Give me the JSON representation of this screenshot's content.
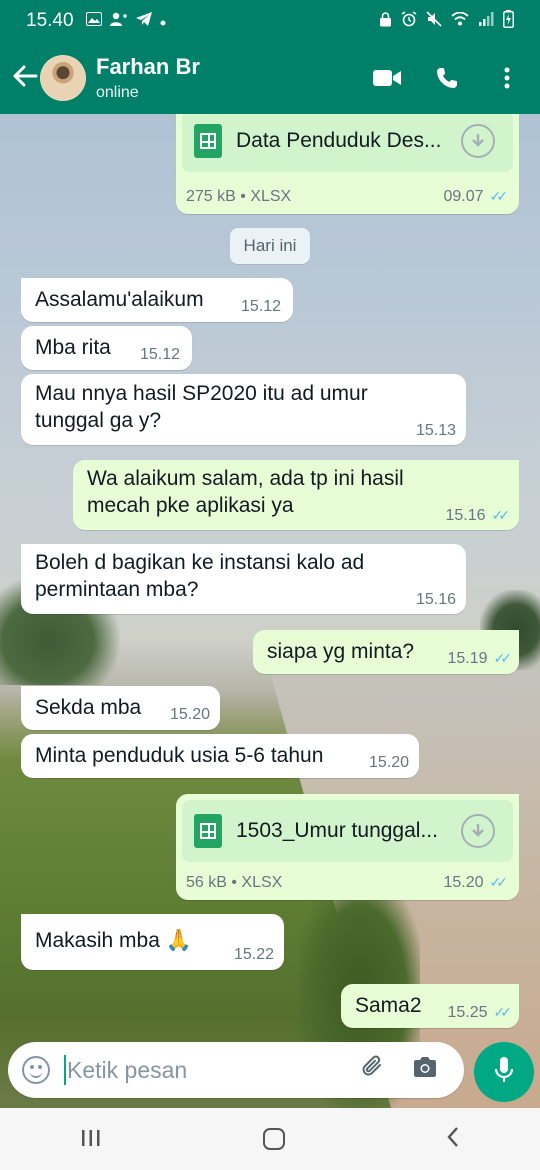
{
  "statusbar": {
    "time": "15.40"
  },
  "header": {
    "contact_name": "Farhan Br",
    "contact_status": "online"
  },
  "day_separator": "Hari ini",
  "messages": [
    {
      "kind": "document",
      "direction": "out",
      "filename": "Data Penduduk Des...",
      "meta": "275 kB • XLSX",
      "time": "09.07",
      "read": true
    },
    {
      "kind": "text",
      "direction": "in",
      "text": "Assalamu'alaikum",
      "time": "15.12"
    },
    {
      "kind": "text",
      "direction": "in",
      "text": "Mba rita",
      "time": "15.12"
    },
    {
      "kind": "text",
      "direction": "in",
      "text": "Mau nnya hasil SP2020 itu ad umur\ntunggal ga y?",
      "time": "15.13"
    },
    {
      "kind": "text",
      "direction": "out",
      "text": "Wa alaikum salam, ada tp ini hasil\nmecah pke aplikasi ya",
      "time": "15.16",
      "read": true
    },
    {
      "kind": "text",
      "direction": "in",
      "text": "Boleh d bagikan ke instansi kalo ad\npermintaan mba?",
      "time": "15.16"
    },
    {
      "kind": "text",
      "direction": "out",
      "text": "siapa yg minta?",
      "time": "15.19",
      "read": true
    },
    {
      "kind": "text",
      "direction": "in",
      "text": "Sekda mba",
      "time": "15.20"
    },
    {
      "kind": "text",
      "direction": "in",
      "text": "Minta penduduk usia 5-6 tahun",
      "time": "15.20"
    },
    {
      "kind": "document",
      "direction": "out",
      "filename": "1503_Umur tunggal...",
      "meta": "56 kB • XLSX",
      "time": "15.20",
      "read": true
    },
    {
      "kind": "text",
      "direction": "in",
      "text": "Makasih mba 🙏",
      "time": "15.22"
    },
    {
      "kind": "text",
      "direction": "out",
      "text": "Sama2",
      "time": "15.25",
      "read": true
    }
  ],
  "composer": {
    "placeholder": "Ketik pesan"
  },
  "colors": {
    "header": "#008069",
    "outgoing_bubble": "#e7fdd6",
    "incoming_bubble": "#ffffff",
    "read_ticks": "#53bdeb",
    "accent": "#00a884"
  }
}
